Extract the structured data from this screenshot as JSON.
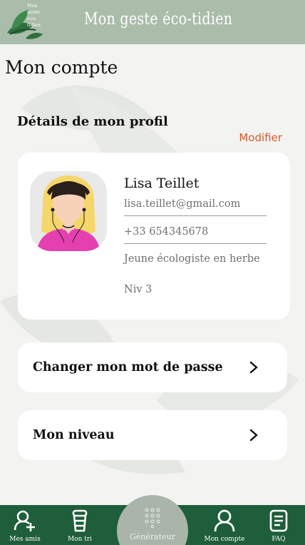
{
  "header": {
    "logo_text": "Mon geste éco-tidien",
    "title": "Mon geste éco-tidien"
  },
  "page": {
    "title": "Mon compte"
  },
  "profile": {
    "section_title": "Détails de mon profil",
    "modify_label": "Modifier",
    "name": "Lisa Teillet",
    "email": "lisa.teillet@gmail.com",
    "phone": "+33 654345678",
    "description": "Jeune écologiste en herbe",
    "level": "Niv 3"
  },
  "actions": {
    "change_password": "Changer mon mot de passe",
    "my_level": "Mon niveau"
  },
  "nav": {
    "friends": "Mes amis",
    "sorting": "Mon tri",
    "generator": "Générateur",
    "account": "Mon compte",
    "faq": "FAQ"
  },
  "colors": {
    "header_bg": "#aabcaa",
    "nav_bg": "#1e5e3a",
    "accent_link": "#d85a2a",
    "page_bg": "#f3f3f1"
  },
  "icons": [
    "logo-leaf-icon",
    "chevron-right-icon",
    "add-user-icon",
    "cup-icon",
    "dots-grid-icon",
    "user-icon",
    "document-icon"
  ]
}
